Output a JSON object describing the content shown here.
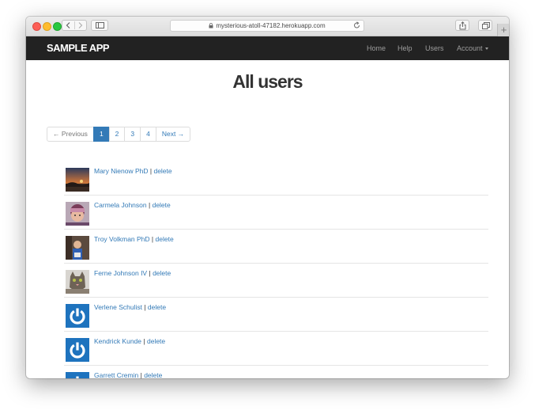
{
  "browser": {
    "url": "mysterious-atoll-47182.herokuapp.com",
    "new_tab_label": "+"
  },
  "navbar": {
    "brand": "SAMPLE APP",
    "links": [
      {
        "label": "Home"
      },
      {
        "label": "Help"
      },
      {
        "label": "Users"
      },
      {
        "label": "Account"
      }
    ]
  },
  "main": {
    "title": "All users",
    "pagination": [
      {
        "label": "← Previous",
        "active": false
      },
      {
        "label": "1",
        "active": true
      },
      {
        "label": "2",
        "active": false
      },
      {
        "label": "3",
        "active": false
      },
      {
        "label": "4",
        "active": false
      },
      {
        "label": "Next →",
        "active": false
      }
    ],
    "separator": "|",
    "delete_label": "delete",
    "users": [
      {
        "name": "Mary Nienow PhD",
        "avatar": "sunset-photo"
      },
      {
        "name": "Carmela Johnson",
        "avatar": "child-photo"
      },
      {
        "name": "Troy Volkman PhD",
        "avatar": "boy-photo"
      },
      {
        "name": "Ferne Johnson IV",
        "avatar": "cat-photo"
      },
      {
        "name": "Verlene Schulist",
        "avatar": "gravatar-default"
      },
      {
        "name": "Kendrick Kunde",
        "avatar": "gravatar-default"
      },
      {
        "name": "Garrett Cremin",
        "avatar": "gravatar-default"
      }
    ]
  },
  "colors": {
    "navbar_bg": "#222222",
    "link": "#337ab7",
    "active_page": "#337ab7",
    "gravatar_bg": "#1e73be"
  }
}
